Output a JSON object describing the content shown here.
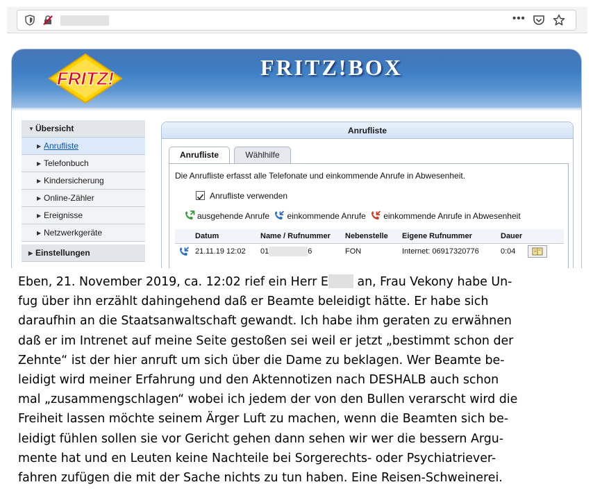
{
  "browser": {
    "url_text": "",
    "more_label": "•••",
    "icons": [
      "shield-icon",
      "broken-lock-icon",
      "pocket-icon",
      "bookmark-star-icon"
    ]
  },
  "fritzbox": {
    "brand_logo": "FRITZ!",
    "header_title": "FRITZ!BOX",
    "sidebar": {
      "items": [
        {
          "label": "Übersicht",
          "level": "top",
          "expanded": true
        },
        {
          "label": "Anrufliste",
          "level": "sub",
          "active": true
        },
        {
          "label": "Telefonbuch",
          "level": "sub"
        },
        {
          "label": "Kindersicherung",
          "level": "sub"
        },
        {
          "label": "Online-Zähler",
          "level": "sub"
        },
        {
          "label": "Ereignisse",
          "level": "sub"
        },
        {
          "label": "Netzwerkgeräte",
          "level": "sub"
        },
        {
          "label": "Einstellungen",
          "level": "top",
          "expanded": false
        }
      ]
    },
    "panel": {
      "title": "Anrufliste",
      "tabs": [
        {
          "label": "Anrufliste",
          "active": true
        },
        {
          "label": "Wählhilfe",
          "active": false
        }
      ],
      "description": "Die Anrufliste erfasst alle Telefonate und einkommende Anrufe in Abwesenheit.",
      "checkbox_label": "Anrufliste verwenden",
      "checkbox_checked": true,
      "legend": {
        "outgoing": "ausgehende Anrufe",
        "incoming": "einkommende Anrufe",
        "missed": "einkommende Anrufe in Abwesenheit"
      },
      "table": {
        "headers": [
          "Datum",
          "Name / Rufnummer",
          "Nebenstelle",
          "Eigene Rufnummer",
          "Dauer"
        ],
        "rows": [
          {
            "type": "incoming",
            "date": "21.11.19 12:02",
            "number_start": "01",
            "number_end": "6",
            "extension": "FON",
            "own_number": "Internet: 06917320776",
            "duration": "0:04"
          }
        ]
      }
    }
  },
  "colors": {
    "fritz_blue": "#2f6db8",
    "panel_border": "#aac1dc",
    "icon_green": "#3a9a3a",
    "icon_blue": "#2a6fc4",
    "icon_red": "#d0381c"
  },
  "story": {
    "lines": [
      {
        "before": "Eben, 21. November 2019, ca. 12:02 rief ein Herr E",
        "after": " an, Frau Vekony habe Un-"
      },
      {
        "text": "fug über ihn erzählt dahingehend daß er Beamte beleidigt hätte. Er habe sich"
      },
      {
        "text": "daraufhin an die Staatsanwaltschaft gewandt. Ich habe ihm geraten zu erwähnen"
      },
      {
        "text": "daß er im Intrenet auf meine Seite gestoßen sei weil er jetzt „bestimmt schon der"
      },
      {
        "text": "Zehnte“ ist der hier anruft um sich über die Dame zu beklagen. Wer Beamte be-"
      },
      {
        "text": "leidigt wird meiner Erfahrung und den Aktennotizen nach DESHALB auch schon"
      },
      {
        "text": "mal „zusammengschlagen“ wobei ich jedem der von den Bullen verarscht wird die"
      },
      {
        "text": "Freiheit lassen möchte seinem Ärger Luft zu machen, wenn die Beamten sich be-"
      },
      {
        "text": "leidigt fühlen sollen sie vor Gericht gehen dann sehen wir wer die bessern Argu-"
      },
      {
        "text": "mente hat und en Leuten keine Nachteile bei Sorgerechts- oder Psychiatriever-"
      },
      {
        "text": "fahren zufügen die mit der Sache nichts zu tun haben. Eine Reisen-Schweinerei."
      }
    ]
  }
}
